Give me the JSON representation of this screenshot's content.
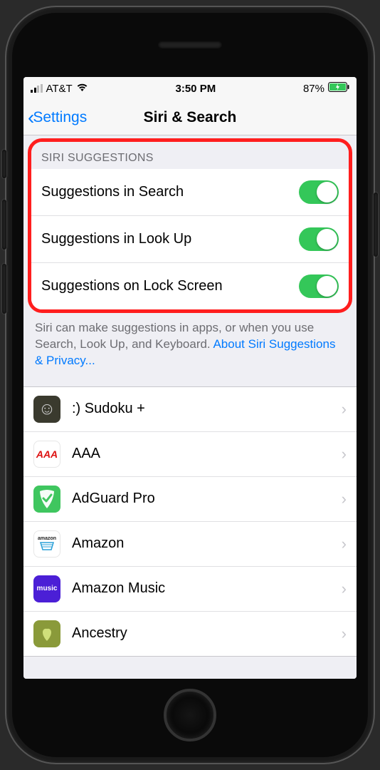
{
  "status": {
    "carrier": "AT&T",
    "time": "3:50 PM",
    "battery_pct": "87%"
  },
  "nav": {
    "back_label": "Settings",
    "title": "Siri & Search"
  },
  "suggestions": {
    "header": "SIRI SUGGESTIONS",
    "rows": [
      {
        "label": "Suggestions in Search",
        "on": true
      },
      {
        "label": "Suggestions in Look Up",
        "on": true
      },
      {
        "label": "Suggestions on Lock Screen",
        "on": true
      }
    ],
    "footer_text": "Siri can make suggestions in apps, or when you use Search, Look Up, and Keyboard.",
    "footer_link": "About Siri Suggestions & Privacy..."
  },
  "apps": [
    {
      "name": ":) Sudoku +",
      "icon": "sudoku"
    },
    {
      "name": "AAA",
      "icon": "aaa"
    },
    {
      "name": "AdGuard Pro",
      "icon": "adguard"
    },
    {
      "name": "Amazon",
      "icon": "amazon"
    },
    {
      "name": "Amazon Music",
      "icon": "amzmusic"
    },
    {
      "name": "Ancestry",
      "icon": "ancestry"
    }
  ]
}
